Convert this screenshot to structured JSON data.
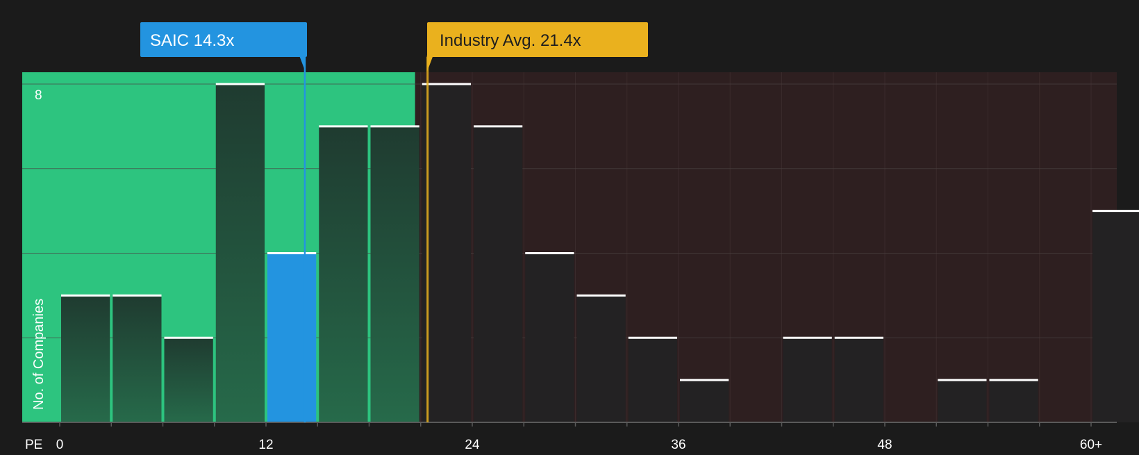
{
  "chart_data": {
    "type": "bar",
    "x_axis_name": "PE",
    "ylabel": "No. of Companies",
    "y_tick_labels": [
      {
        "value": 8,
        "label": "8"
      }
    ],
    "ylim": [
      0,
      8.3
    ],
    "x_ticks": [
      {
        "value": 0,
        "label": "0"
      },
      {
        "value": 12,
        "label": "12"
      },
      {
        "value": 24,
        "label": "24"
      },
      {
        "value": 36,
        "label": "36"
      },
      {
        "value": 48,
        "label": "48"
      },
      {
        "value": 60,
        "label": "60+"
      }
    ],
    "bins": [
      {
        "start": 0,
        "end": 3,
        "count": 3,
        "zone": "green"
      },
      {
        "start": 3,
        "end": 6,
        "count": 3,
        "zone": "green"
      },
      {
        "start": 6,
        "end": 9,
        "count": 2,
        "zone": "green"
      },
      {
        "start": 9,
        "end": 12,
        "count": 8,
        "zone": "green"
      },
      {
        "start": 12,
        "end": 15,
        "count": 4,
        "zone": "green",
        "highlight": true
      },
      {
        "start": 15,
        "end": 18,
        "count": 7,
        "zone": "green"
      },
      {
        "start": 18,
        "end": 21,
        "count": 7,
        "zone": "green"
      },
      {
        "start": 21,
        "end": 24,
        "count": 8,
        "zone": "red"
      },
      {
        "start": 24,
        "end": 27,
        "count": 7,
        "zone": "red"
      },
      {
        "start": 27,
        "end": 30,
        "count": 4,
        "zone": "red"
      },
      {
        "start": 30,
        "end": 33,
        "count": 3,
        "zone": "red"
      },
      {
        "start": 33,
        "end": 36,
        "count": 2,
        "zone": "red"
      },
      {
        "start": 36,
        "end": 39,
        "count": 1,
        "zone": "red"
      },
      {
        "start": 39,
        "end": 42,
        "count": 0,
        "zone": "red"
      },
      {
        "start": 42,
        "end": 45,
        "count": 2,
        "zone": "red"
      },
      {
        "start": 45,
        "end": 48,
        "count": 2,
        "zone": "red"
      },
      {
        "start": 48,
        "end": 51,
        "count": 0,
        "zone": "red"
      },
      {
        "start": 51,
        "end": 54,
        "count": 1,
        "zone": "red"
      },
      {
        "start": 54,
        "end": 57,
        "count": 1,
        "zone": "red"
      },
      {
        "start": 57,
        "end": 60,
        "count": 0,
        "zone": "red"
      },
      {
        "start": 60,
        "end": 63,
        "count": 5,
        "zone": "red"
      }
    ],
    "company_marker": {
      "label": "SAIC 14.3x",
      "value": 14.3
    },
    "industry_marker": {
      "label": "Industry Avg. 21.4x",
      "value": 21.4
    },
    "colors": {
      "background": "#1b1b1b",
      "green_zone": "#2dc47f",
      "red_zone": "#2e1f20",
      "green_bar_top": "#1f3b30",
      "green_bar_bottom": "#266a4a",
      "dark_bar": "#232223",
      "highlight_bar": "#2394e0",
      "company_marker": "#2394e0",
      "industry_marker": "#eab11e",
      "cap_line": "#ffffff",
      "grid": "#4a4242",
      "axis": "#5a5a5a",
      "text": "#ffffff"
    }
  }
}
